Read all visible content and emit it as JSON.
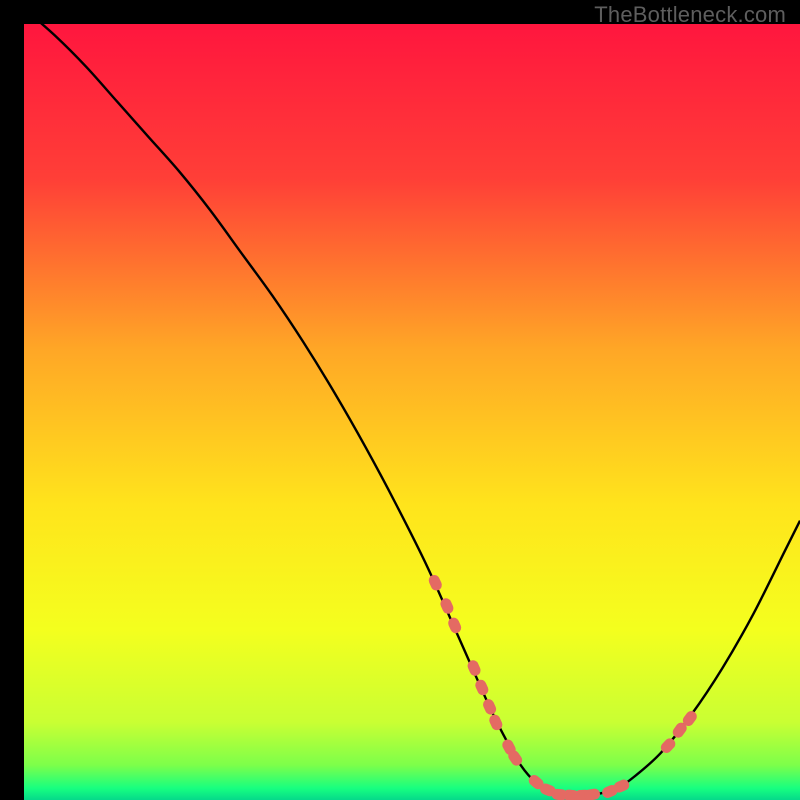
{
  "watermark": "TheBottleneck.com",
  "colors": {
    "background": "#000000",
    "gradient_stops": [
      {
        "offset": 0.0,
        "color": "#ff163e"
      },
      {
        "offset": 0.2,
        "color": "#ff3f37"
      },
      {
        "offset": 0.42,
        "color": "#ffa726"
      },
      {
        "offset": 0.62,
        "color": "#ffe41c"
      },
      {
        "offset": 0.78,
        "color": "#f4ff1e"
      },
      {
        "offset": 0.9,
        "color": "#c9ff33"
      },
      {
        "offset": 0.955,
        "color": "#7dff4a"
      },
      {
        "offset": 0.985,
        "color": "#17ff80"
      },
      {
        "offset": 1.0,
        "color": "#05d98a"
      }
    ],
    "curve": "#000000",
    "marker_fill": "#e46a63",
    "marker_stroke": "#cf5a55"
  },
  "chart_data": {
    "type": "line",
    "title": "",
    "xlabel": "",
    "ylabel": "",
    "xlim": [
      0,
      100
    ],
    "ylim": [
      0,
      100
    ],
    "curve": {
      "x": [
        0,
        4,
        8,
        12,
        16,
        20,
        24,
        28,
        32,
        36,
        40,
        44,
        48,
        52,
        56,
        60,
        62,
        64,
        66,
        68,
        70,
        72,
        74,
        76,
        78,
        82,
        86,
        90,
        94,
        98,
        100
      ],
      "y": [
        102,
        98.5,
        94.5,
        90.0,
        85.5,
        81.0,
        76.0,
        70.5,
        65.0,
        59.0,
        52.5,
        45.5,
        38.0,
        30.0,
        21.0,
        12.0,
        8.0,
        4.5,
        2.2,
        1.0,
        0.6,
        0.6,
        0.8,
        1.3,
        2.5,
        6.0,
        11.0,
        17.0,
        24.0,
        32.0,
        36.0
      ]
    },
    "markers": [
      {
        "x": 53.0,
        "y": 28.0
      },
      {
        "x": 54.5,
        "y": 25.0
      },
      {
        "x": 55.5,
        "y": 22.5
      },
      {
        "x": 58.0,
        "y": 17.0
      },
      {
        "x": 59.0,
        "y": 14.5
      },
      {
        "x": 60.0,
        "y": 12.0
      },
      {
        "x": 60.8,
        "y": 10.0
      },
      {
        "x": 62.5,
        "y": 6.8
      },
      {
        "x": 63.3,
        "y": 5.4
      },
      {
        "x": 66.0,
        "y": 2.3
      },
      {
        "x": 67.5,
        "y": 1.3
      },
      {
        "x": 69.0,
        "y": 0.7
      },
      {
        "x": 70.5,
        "y": 0.6
      },
      {
        "x": 72.0,
        "y": 0.6
      },
      {
        "x": 73.2,
        "y": 0.7
      },
      {
        "x": 75.5,
        "y": 1.1
      },
      {
        "x": 77.0,
        "y": 1.8
      },
      {
        "x": 83.0,
        "y": 7.0
      },
      {
        "x": 84.5,
        "y": 9.0
      },
      {
        "x": 85.8,
        "y": 10.5
      }
    ]
  }
}
